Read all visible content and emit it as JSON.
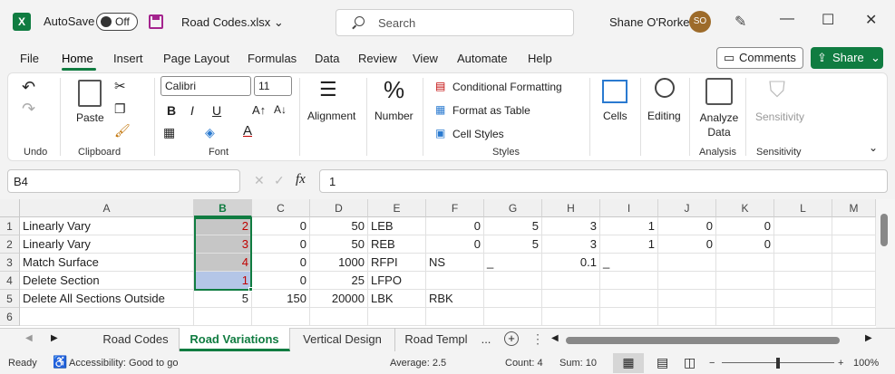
{
  "app": {
    "logo": "X",
    "autosave_label": "AutoSave",
    "autosave_state": "Off",
    "filename": "Road Codes.xlsx",
    "search_placeholder": "Search",
    "user_name": "Shane O'Rorke",
    "user_initials": "SO",
    "window_controls": [
      "—",
      "☐",
      "✕"
    ]
  },
  "menu": {
    "tabs": [
      "File",
      "Home",
      "Insert",
      "Page Layout",
      "Formulas",
      "Data",
      "Review",
      "View",
      "Automate",
      "Help"
    ],
    "active_tab": "Home",
    "comments_label": "Comments",
    "share_label": "Share"
  },
  "ribbon": {
    "undo_label": "Undo",
    "clipboard_label": "Clipboard",
    "paste_label": "Paste",
    "font_label": "Font",
    "font_name": "Calibri",
    "font_size": "11",
    "alignment_label": "Alignment",
    "number_label": "Number",
    "conditional_formatting": "Conditional Formatting",
    "format_as_table": "Format as Table",
    "cell_styles": "Cell Styles",
    "styles_label": "Styles",
    "cells_label": "Cells",
    "editing_label": "Editing",
    "analyze_data": "Analyze Data",
    "analysis_label": "Analysis",
    "sensitivity_button": "Sensitivity",
    "sensitivity_label": "Sensitivity"
  },
  "formula_bar": {
    "name_box": "B4",
    "fx": "fx",
    "value": "1"
  },
  "grid": {
    "columns": [
      "A",
      "B",
      "C",
      "D",
      "E",
      "F",
      "G",
      "H",
      "I",
      "J",
      "K",
      "L",
      "M"
    ],
    "rows": [
      "1",
      "2",
      "3",
      "4",
      "5",
      "6"
    ],
    "cells": [
      [
        "Linearly Vary",
        "2",
        "0",
        "50",
        "LEB",
        "0",
        "5",
        "3",
        "1",
        "0",
        "0",
        "",
        ""
      ],
      [
        "Linearly Vary",
        "3",
        "0",
        "50",
        "REB",
        "0",
        "5",
        "3",
        "1",
        "0",
        "0",
        "",
        ""
      ],
      [
        "Match Surface",
        "4",
        "0",
        "1000",
        "RFPI",
        "NS",
        "_",
        "0.1",
        "_",
        "",
        "",
        "",
        ""
      ],
      [
        "Delete Section",
        "1",
        "0",
        "25",
        "LFPO",
        "",
        "",
        "",
        "",
        "",
        "",
        "",
        ""
      ],
      [
        "Delete All Sections Outside",
        "5",
        "150",
        "20000",
        "LBK",
        "RBK",
        "",
        "",
        "",
        "",
        "",
        "",
        ""
      ],
      [
        "",
        "",
        "",
        "",
        "",
        "",
        "",
        "",
        "",
        "",
        "",
        "",
        ""
      ]
    ]
  },
  "sheets": {
    "tabs": [
      "Road Codes",
      "Road Variations",
      "Vertical Design",
      "Road Templ"
    ],
    "active": "Road Variations",
    "more": "...",
    "add": "+"
  },
  "status": {
    "ready": "Ready",
    "accessibility": "Accessibility: Good to go",
    "average": "Average: 2.5",
    "count": "Count: 4",
    "sum": "Sum: 10",
    "zoom": "100%"
  }
}
